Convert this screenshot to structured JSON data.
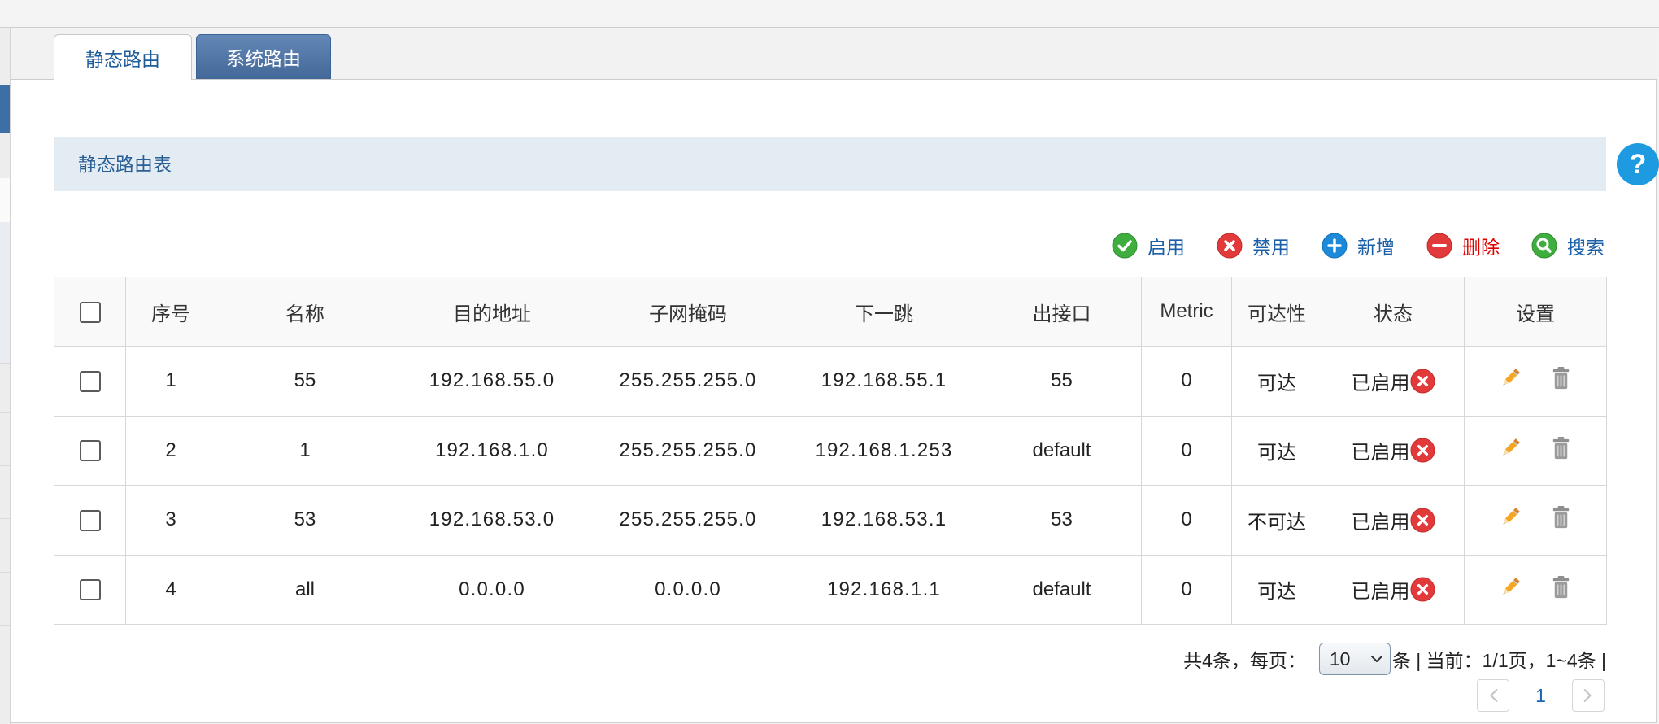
{
  "tabs": [
    {
      "label": "静态路由",
      "active": true
    },
    {
      "label": "系统路由",
      "active": false
    }
  ],
  "section": {
    "title": "静态路由表"
  },
  "help": {
    "label": "?",
    "icon": "help-icon"
  },
  "toolbar": [
    {
      "label": "启用",
      "icon": "enable-icon"
    },
    {
      "label": "禁用",
      "icon": "disable-icon"
    },
    {
      "label": "新增",
      "icon": "add-icon"
    },
    {
      "label": "删除",
      "icon": "delete-icon"
    },
    {
      "label": "搜索",
      "icon": "search-icon"
    }
  ],
  "table": {
    "headers": [
      "序号",
      "名称",
      "目的地址",
      "子网掩码",
      "下一跳",
      "出接口",
      "Metric",
      "可达性",
      "状态",
      "设置"
    ],
    "rows": [
      {
        "index": "1",
        "name": "55",
        "destination": "192.168.55.0",
        "netmask": "255.255.255.0",
        "next_hop": "192.168.55.1",
        "interface": "55",
        "metric": "0",
        "reachability": "可达",
        "status": "已启用",
        "checked": false
      },
      {
        "index": "2",
        "name": "1",
        "destination": "192.168.1.0",
        "netmask": "255.255.255.0",
        "next_hop": "192.168.1.253",
        "interface": "default",
        "metric": "0",
        "reachability": "可达",
        "status": "已启用",
        "checked": false
      },
      {
        "index": "3",
        "name": "53",
        "destination": "192.168.53.0",
        "netmask": "255.255.255.0",
        "next_hop": "192.168.53.1",
        "interface": "53",
        "metric": "0",
        "reachability": "不可达",
        "status": "已启用",
        "checked": false
      },
      {
        "index": "4",
        "name": "all",
        "destination": "0.0.0.0",
        "netmask": "0.0.0.0",
        "next_hop": "192.168.1.1",
        "interface": "default",
        "metric": "0",
        "reachability": "可达",
        "status": "已启用",
        "checked": false
      }
    ],
    "status_icon": "disable-status-icon",
    "row_actions": [
      "edit-icon",
      "trash-icon"
    ]
  },
  "pagination": {
    "total_label": "共4条，每页：",
    "page_size": "10",
    "summary": "条 | 当前：1/1页，1~4条 |",
    "current_page": "1"
  },
  "colors": {
    "link_blue": "#1b5fa8",
    "tab_active_text": "#1f5c99",
    "tab_inactive_bg": "#4a74aa",
    "section_bg": "#e4ecf3",
    "section_text": "#2a5f96",
    "delete_red": "#e00000",
    "table_border": "#d7d7d7",
    "header_bg": "#f9f9f9",
    "help_blue": "#1e9be0",
    "page_link": "#1a66b0"
  }
}
